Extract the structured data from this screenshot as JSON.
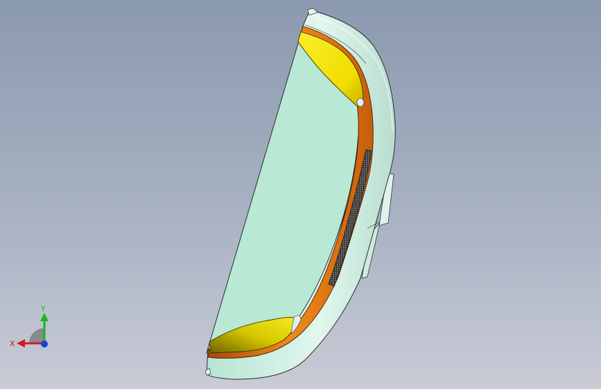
{
  "viewport": {
    "name": "3d-cad-viewport",
    "background_top": "#8b99ae",
    "background_bottom": "#c9cbd6"
  },
  "model": {
    "shell_color": "#c6ede0",
    "face_color": "#b9e8d4",
    "rim_orange": "#e37612",
    "cap_yellow": "#f4e800",
    "edge_color": "#2a2a2a"
  },
  "triad": {
    "x_label": "X",
    "y_label": "Y",
    "x_color": "#d21a1a",
    "y_color": "#1fb41f",
    "z_color": "#1a3fd2"
  }
}
